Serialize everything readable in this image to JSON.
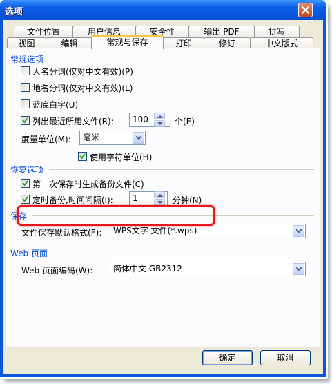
{
  "window": {
    "title": "选项"
  },
  "tabs_back": [
    {
      "label": "文件位置"
    },
    {
      "label": "用户信息"
    },
    {
      "label": "安全性"
    },
    {
      "label": "输出 PDF"
    },
    {
      "label": "拼写"
    }
  ],
  "tabs_front": [
    {
      "label": "视图"
    },
    {
      "label": "编辑"
    },
    {
      "label": "常规与保存"
    },
    {
      "label": "打印"
    },
    {
      "label": "修订"
    },
    {
      "label": "中文版式"
    }
  ],
  "general": {
    "title": "常规选项",
    "person_name": "人名分词(仅对中文有效)(P)",
    "place_name": "地名分词(仅对中文有效)(L)",
    "blue_bg": "蓝底白字(U)",
    "recent_files": "列出最近所用文件(R):",
    "recent_count": "100",
    "recent_unit": "个(E)",
    "measure_label": "度量单位(M):",
    "measure_value": "毫米",
    "char_unit": "使用字符单位(H)"
  },
  "recovery": {
    "title": "恢复选项",
    "first_backup": "第一次保存时生成备份文件(C)",
    "timed_backup": "定时备份,时间间隔(I):",
    "interval": "1",
    "interval_unit": "分钟(N)"
  },
  "save": {
    "title": "保存",
    "format_label": "文件保存默认格式(F):",
    "format_value": "WPS文字 文件(*.wps)"
  },
  "web": {
    "title": "Web 页面",
    "encoding_label": "Web 页面编码(W):",
    "encoding_value": "简体中文 GB2312"
  },
  "buttons": {
    "ok": "确定",
    "cancel": "取消"
  },
  "colors": {
    "accent": "#0046d5",
    "highlight": "#e8141c",
    "titlebar": "#0a5fe8"
  }
}
